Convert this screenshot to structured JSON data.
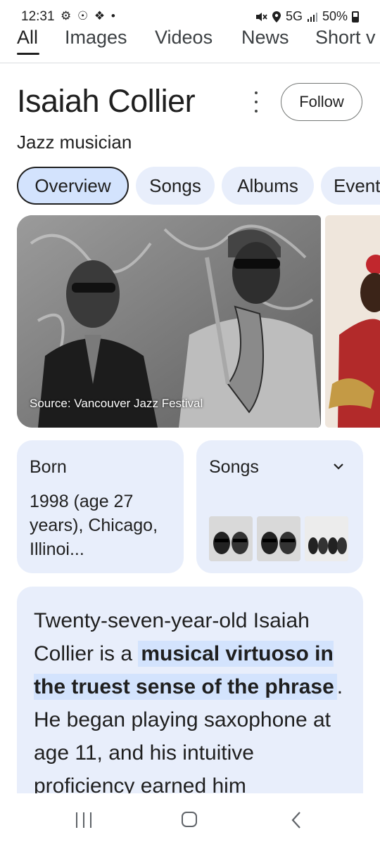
{
  "status_bar": {
    "time": "12:31",
    "notification_icons": "⚙ ☉ ❖ •",
    "network": "5G",
    "battery": "50%"
  },
  "search_tabs": [
    {
      "label": "All",
      "active": true
    },
    {
      "label": "Images"
    },
    {
      "label": "Videos"
    },
    {
      "label": "News"
    },
    {
      "label": "Short v"
    }
  ],
  "entity": {
    "title": "Isaiah Collier",
    "subtitle": "Jazz musician",
    "follow_label": "Follow"
  },
  "chips": [
    {
      "label": "Overview",
      "selected": true
    },
    {
      "label": "Songs"
    },
    {
      "label": "Albums"
    },
    {
      "label": "Event"
    }
  ],
  "image": {
    "source_label": "Source: Vancouver Jazz Festival"
  },
  "born_card": {
    "title": "Born",
    "value": "1998 (age 27 years), Chicago, Illinoi..."
  },
  "songs_card": {
    "title": "Songs"
  },
  "description": {
    "part1": "Twenty-seven-year-old Isaiah Collier is a ",
    "highlight": "musical virtuoso in the truest sense of the phrase",
    "part2": ". He began playing saxophone at age 11, and his intuitive proficiency earned him"
  },
  "colors": {
    "card_bg": "#e8eefb",
    "chip_selected_bg": "#d3e3fd",
    "text_primary": "#1f1f1f"
  }
}
